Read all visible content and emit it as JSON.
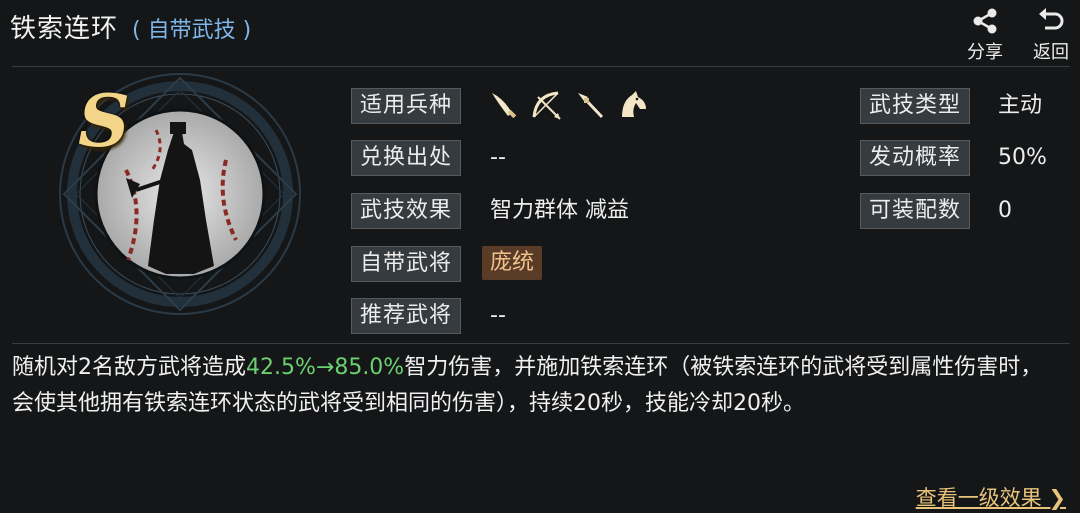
{
  "header": {
    "title": "铁索连环",
    "subtitle": "( 自带武技 )",
    "share_label": "分享",
    "back_label": "返回"
  },
  "skill": {
    "grade": "S",
    "troop_label": "适用兵种",
    "troop_icons": [
      "saber-icon",
      "bow-icon",
      "spear-icon",
      "horse-icon"
    ],
    "source_label": "兑换出处",
    "source_value": "--",
    "effect_label": "武技效果",
    "effect_value": "智力群体 减益",
    "general_label": "自带武将",
    "general_value": "庞统",
    "recommend_label": "推荐武将",
    "recommend_value": "--",
    "type_label": "武技类型",
    "type_value": "主动",
    "rate_label": "发动概率",
    "rate_value": "50%",
    "equip_label": "可装配数",
    "equip_value": "0"
  },
  "description": {
    "prefix": "随机对2名敌方武将造成",
    "highlight": "42.5%→85.0%",
    "suffix": "智力伤害，并施加铁索连环（被铁索连环的武将受到属性伤害时，会使其他拥有铁索连环状态的武将受到相同的伤害），持续20秒，技能冷却20秒。"
  },
  "footer": {
    "link_label": "查看一级效果 ❯"
  },
  "colors": {
    "accent_gold": "#f3d58a",
    "highlight_green": "#6cd070",
    "subtitle_blue": "#7fb6ea",
    "link_gold": "#e8c37a"
  }
}
